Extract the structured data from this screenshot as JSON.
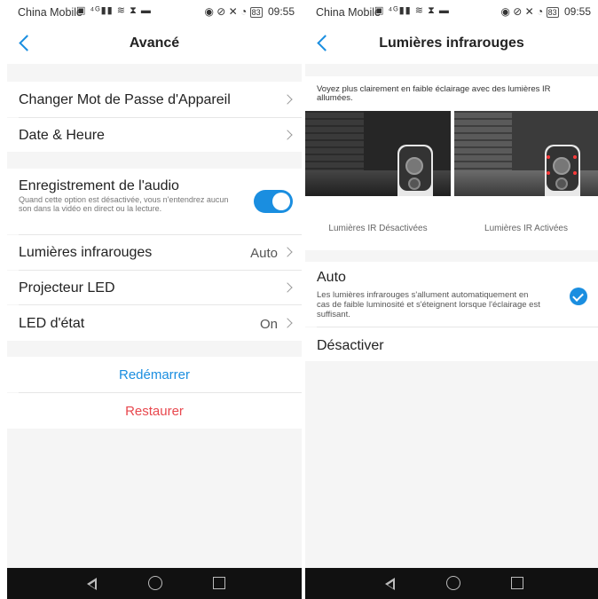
{
  "left": {
    "status": {
      "carrier": "China Mobile",
      "time": "09:55",
      "battery": "83"
    },
    "title": "Avancé",
    "items": {
      "password": "Changer Mot de Passe d'Appareil",
      "datetime": "Date & Heure",
      "audio": "Enregistrement de l'audio",
      "audio_desc": "Quand cette option est désactivée, vous n'entendrez aucun son dans la vidéo en direct ou la lecture.",
      "ir": "Lumières infrarouges",
      "ir_value": "Auto",
      "led_projector": "Projecteur LED",
      "status_led": "LED d'état",
      "status_led_value": "On"
    },
    "actions": {
      "reboot": "Redémarrer",
      "restore": "Restaurer"
    },
    "colors": {
      "accent": "#1a8ee0",
      "reboot": "#1a8ee0",
      "restore": "#e8484e"
    }
  },
  "right": {
    "status": {
      "carrier": "China Mobile",
      "time": "09:55",
      "battery": "83"
    },
    "title": "Lumières infrarouges",
    "intro": "Voyez plus clairement en faible éclairage avec des lumières IR allumées.",
    "images": {
      "off_caption": "Lumières IR Désactivées",
      "on_caption": "Lumières IR Activées"
    },
    "options": {
      "auto": "Auto",
      "auto_desc": "Les lumières infrarouges s'allument automatiquement en cas de faible luminosité et s'éteignent lorsque l'éclairage est suffisant.",
      "auto_selected": true,
      "off": "Désactiver"
    }
  }
}
